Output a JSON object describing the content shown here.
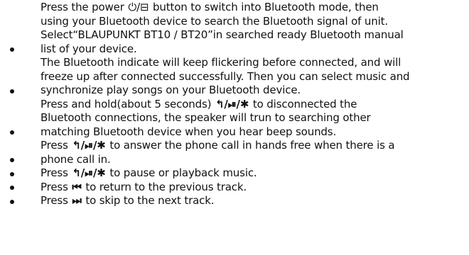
{
  "icons": {
    "power": "⏻/⊟",
    "multi": "↰/⏯/✱",
    "prev": "⏮",
    "next": "⏭"
  },
  "bullets": [
    {
      "l1a": "Press the power ",
      "l1b": " button to switch into Bluetooth mode, then",
      "l2": "using your Bluetooth device to search the Bluetooth signal of unit.",
      "l3": "Select“BLAUPUNKT BT10 / BT20”in searched ready Bluetooth manual",
      "l4": "list of your device."
    },
    {
      "l1": "The Bluetooth indicate will keep flickering before connected, and will",
      "l2": "freeze up after connected successfully. Then you can select music and",
      "l3": "synchronize play songs on your Bluetooth device."
    },
    {
      "l1a": "Press and hold(about 5 seconds) ",
      "l1b": " to disconnected the",
      "l2": "Bluetooth connections, the speaker will trun to searching other",
      "l3": "matching Bluetooth device when you hear beep sounds."
    },
    {
      "l1a": "Press ",
      "l1b": " to answer the phone call in hands free when there is a",
      "l2": "phone call in."
    },
    {
      "l1a": "Press ",
      "l1b": " to pause or playback music."
    },
    {
      "l1a": "Press ",
      "l1b": " to return to the previous track."
    },
    {
      "l1a": "Press ",
      "l1b": " to skip to the next track."
    }
  ]
}
